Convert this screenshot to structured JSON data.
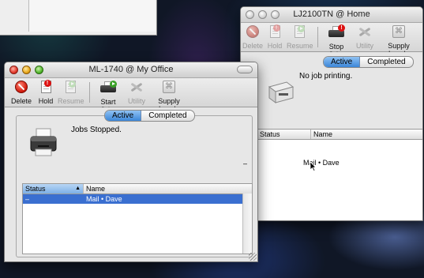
{
  "desktop": {
    "description_none": ""
  },
  "back_window": {
    "title": "LJ2100TN @ Home",
    "toolbar": {
      "delete": "Delete",
      "hold": "Hold",
      "resume": "Resume",
      "stop_jobs": "Stop Jobs",
      "utility": "Utility",
      "supply_levels": "Supply Levels"
    },
    "tabs": {
      "active": "Active",
      "completed": "Completed"
    },
    "status": "No job printing.",
    "columns": {
      "status": "Status",
      "name": "Name"
    },
    "job_name": "Mail • Dave"
  },
  "front_window": {
    "title": "ML-1740 @ My Office",
    "toolbar": {
      "delete": "Delete",
      "hold": "Hold",
      "resume": "Resume",
      "start_jobs": "Start Jobs",
      "utility": "Utility",
      "supply_levels": "Supply Levels"
    },
    "tabs": {
      "active": "Active",
      "completed": "Completed"
    },
    "status": "Jobs Stopped.",
    "progress_marker": "–",
    "columns": {
      "status": "Status",
      "name": "Name"
    },
    "jobs": [
      {
        "status": "–",
        "name": "Mail • Dave",
        "selected": true
      }
    ]
  },
  "colors": {
    "selection": "#3a6fd0",
    "active_tab": "#5a9be6"
  }
}
